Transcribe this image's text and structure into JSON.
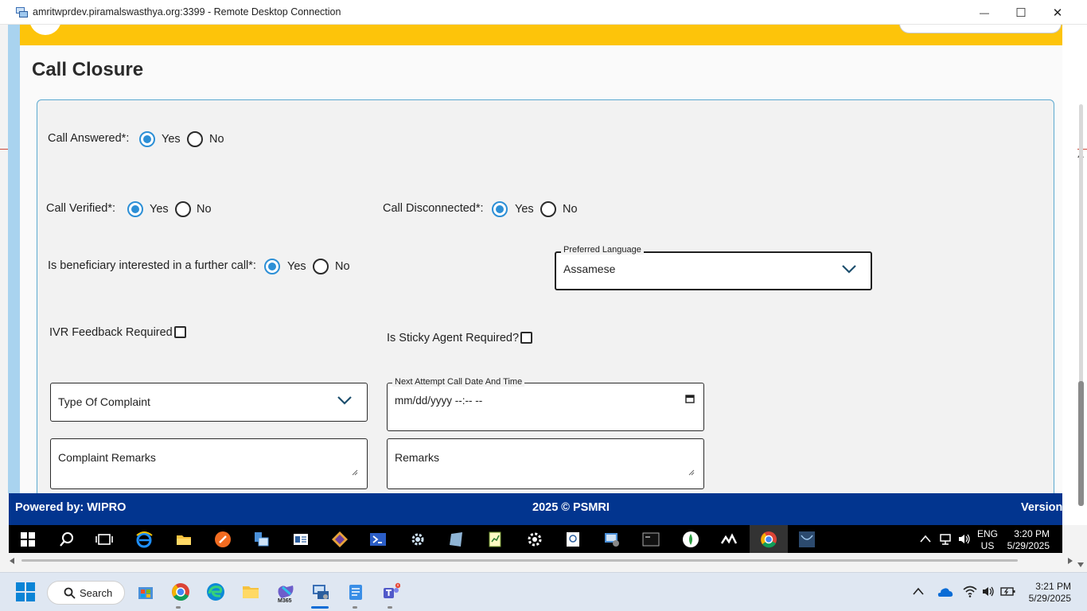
{
  "window": {
    "title": "amritwprdev.piramalswasthya.org:3399 - Remote Desktop Connection",
    "minimize": "—",
    "maximize": "☐",
    "close": "✕"
  },
  "page": {
    "title": "Call Closure"
  },
  "form": {
    "call_answered": {
      "label": "Call Answered*:",
      "yes": "Yes",
      "no": "No",
      "selected": "Yes"
    },
    "call_verified": {
      "label": "Call Verified*:",
      "yes": "Yes",
      "no": "No",
      "selected": "Yes"
    },
    "call_disconnected": {
      "label": "Call Disconnected*:",
      "yes": "Yes",
      "no": "No",
      "selected": "Yes"
    },
    "further_call": {
      "label": "Is beneficiary interested in a further call*:",
      "yes": "Yes",
      "no": "No",
      "selected": "Yes"
    },
    "preferred_language": {
      "label": "Preferred Language",
      "value": "Assamese"
    },
    "ivr_feedback": {
      "label": "IVR Feedback Required",
      "checked": false
    },
    "sticky_agent": {
      "label": "Is Sticky Agent Required?",
      "checked": false
    },
    "type_of_complaint": {
      "placeholder": "Type Of Complaint"
    },
    "next_attempt": {
      "label": "Next Attempt Call Date And Time",
      "placeholder": "mm/dd/yyyy --:-- --"
    },
    "complaint_remarks": {
      "placeholder": "Complaint Remarks"
    },
    "remarks": {
      "placeholder": "Remarks"
    }
  },
  "footer": {
    "powered_by": "Powered by: WIPRO",
    "copyright": "2025 © PSMRI",
    "version": "Version"
  },
  "remote_taskbar": {
    "lang_line1": "ENG",
    "lang_line2": "US",
    "time": "3:20 PM",
    "date": "5/29/2025",
    "icons": [
      "start-icon",
      "search-icon",
      "task-view-icon",
      "internet-explorer-icon",
      "file-explorer-icon",
      "app-icon",
      "remote-icon",
      "app-icon",
      "powershell-icon",
      "settings-gear-icon",
      "app-icon",
      "notepad-icon",
      "settings-icon",
      "app-icon",
      "remote-desktop-icon",
      "cmd-icon",
      "app-icon",
      "app-icon",
      "chrome-icon",
      "app-icon"
    ]
  },
  "local_taskbar": {
    "search_label": "Search",
    "time": "3:21 PM",
    "date": "5/29/2025",
    "m365_label": "M365"
  },
  "colors": {
    "header_yellow": "#fdc40a",
    "footer_blue": "#02358f",
    "radio_blue": "#2c8fd6",
    "card_border": "#5ba9d0"
  }
}
